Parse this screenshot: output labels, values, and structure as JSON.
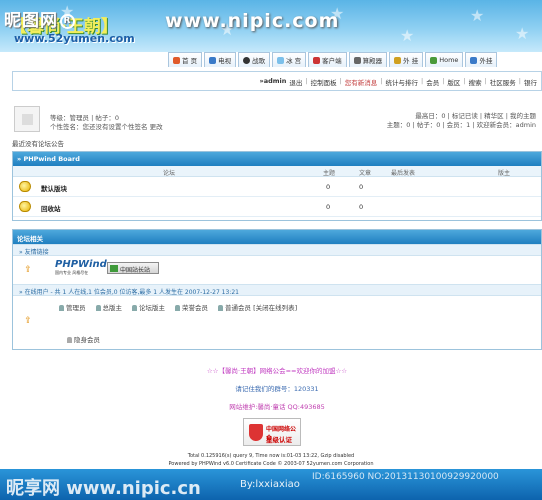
{
  "watermark": {
    "top_left": "昵图网",
    "top_mid": "www.nipic.com",
    "bottom_left": "昵享网 www.nipic.cn",
    "bottom_right": "By:lxxiaxiao",
    "bottom_id": "ID:6165960 NO:20131130100929920000"
  },
  "brand": {
    "logo_text": "【馨尚·王朝】",
    "url": "www.52yumen.com"
  },
  "nav": {
    "tabs": [
      "首 页",
      "电视",
      "战歌",
      "冰 宫",
      "客户端",
      "算殿器",
      "外 挂",
      "Home",
      "外挂"
    ]
  },
  "topbar": {
    "user": "»admin",
    "links": [
      "退出",
      "控制面板",
      "您有新消息",
      "统计与排行",
      "会员",
      "版区",
      "搜索",
      "社区服务",
      "银行"
    ]
  },
  "user_info": {
    "line1": "等级：管理员 | 帖子：0",
    "line2": "个性签名：您还没有设置个性签名 更改",
    "right1": "最高日：0 | 标记已读 | 精华区 | 我的主题",
    "right2": "主题：0 | 帖子：0 | 会员：1 | 欢迎新会员：admin"
  },
  "notice": "最近没有论坛公告",
  "board": {
    "title": "» PHPwind Board",
    "headers": [
      "论坛",
      "主题",
      "文章",
      "最后发表",
      "版主"
    ],
    "forums": [
      {
        "name": "默认版块",
        "topics": "0",
        "posts": "0"
      },
      {
        "name": "回收站",
        "topics": "0",
        "posts": "0"
      }
    ]
  },
  "related": {
    "title": "论坛相关",
    "links_header": "» 友情链接",
    "phpwind_logo": "PHPWind",
    "phpwind_tag": "国内专业 风格尽在",
    "cn_badge": "中国站长站",
    "online_header": "» 在线用户 - 共 1 人在线,1 位会员,0 位访客,最多 1 人发生在 2007-12-27 13:21",
    "user_types": [
      "管理员",
      "总版主",
      "论坛版主",
      "荣誉会员",
      "普通会员 [关闭在线列表]"
    ],
    "hidden_member": "隐身会员"
  },
  "footer": {
    "slogan": "☆☆【馨尚·王朝】网络公会==欢迎你的加盟☆☆",
    "qq_group": "请记住我们的群号：120331",
    "maintain": "网站维护:馨尚·童话 QQ:493685",
    "badge_line1": "中国网络公会",
    "badge_line2": "星级认证",
    "stats": "Total 0.125916(s) query 9, Time now is:01-03 13:22, Gzip disabled",
    "powered": "Powered by PHPWind v6.0 Certificate Code © 2003-07 52yumen.com Corporation"
  },
  "colors": {
    "accent": "#1f7fc0",
    "header_blue": "#5ab4e6",
    "badge_red": "#cc0000"
  }
}
